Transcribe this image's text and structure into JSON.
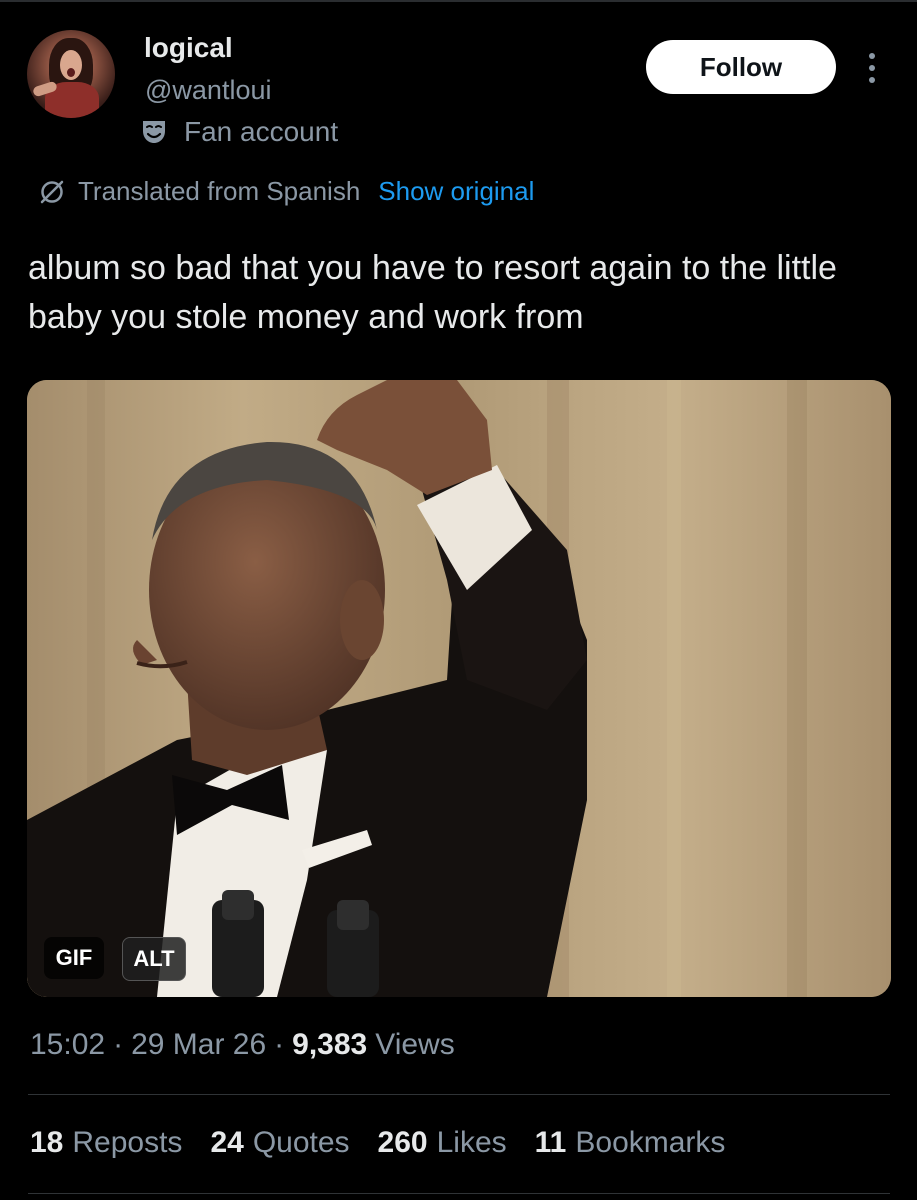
{
  "author": {
    "display_name": "logical",
    "handle": "@wantloui",
    "label": "Fan account",
    "label_icon": "theater-mask-icon",
    "avatar_icon": "avatar-photo"
  },
  "actions": {
    "follow_label": "Follow",
    "more_icon": "vertical-ellipsis-icon"
  },
  "translation": {
    "icon": "translate-icon",
    "text": "Translated from Spanish",
    "show_original_label": "Show original"
  },
  "tweet": {
    "text": "album so bad that you have to resort again to the little baby you stole money and work from"
  },
  "media": {
    "type": "gif",
    "gif_badge": "GIF",
    "alt_badge": "ALT"
  },
  "meta": {
    "time": "15:02",
    "separator": "·",
    "date": "29 Mar 26",
    "views_count": "9,383",
    "views_label": "Views"
  },
  "stats": [
    {
      "count": "18",
      "label": "Reposts"
    },
    {
      "count": "24",
      "label": "Quotes"
    },
    {
      "count": "260",
      "label": "Likes"
    },
    {
      "count": "11",
      "label": "Bookmarks"
    }
  ],
  "colors": {
    "background": "#000000",
    "text_primary": "#e7e9ea",
    "text_secondary": "#8b98a5",
    "link": "#1d9bf0",
    "button_bg": "#ffffff"
  }
}
